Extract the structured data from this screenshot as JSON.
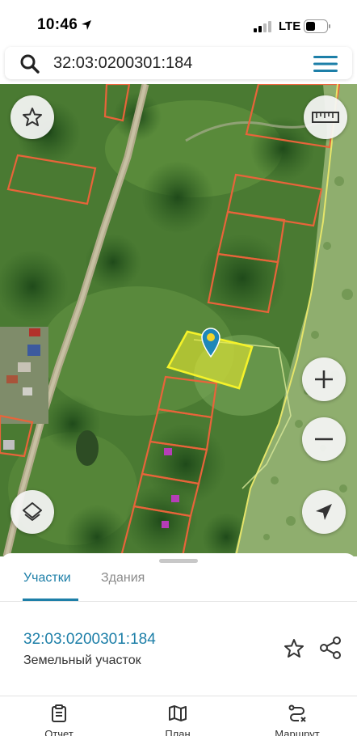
{
  "status_bar": {
    "time": "10:46",
    "carrier": "LTE"
  },
  "search": {
    "query": "32:03:0200301:184"
  },
  "map_controls": {
    "favorite_icon": "star-outline-icon",
    "ruler_icon": "ruler-icon",
    "zoom_in_icon": "plus-icon",
    "zoom_out_icon": "minus-icon",
    "layers_icon": "layers-icon",
    "locate_icon": "navigation-arrow-icon"
  },
  "sheet": {
    "tabs": [
      {
        "label": "Участки",
        "active": true
      },
      {
        "label": "Здания",
        "active": false
      }
    ],
    "parcel": {
      "id": "32:03:0200301:184",
      "type": "Земельный участок"
    }
  },
  "bottom_nav": [
    {
      "label": "Отчет",
      "icon": "clipboard-icon"
    },
    {
      "label": "План",
      "icon": "map-icon"
    },
    {
      "label": "Маршрут",
      "icon": "route-icon"
    }
  ],
  "colors": {
    "accent": "#1d7fa8",
    "parcel_border": "#e8643a",
    "selected_parcel": "#f2ee2e",
    "zone_border": "#e5e56a"
  }
}
